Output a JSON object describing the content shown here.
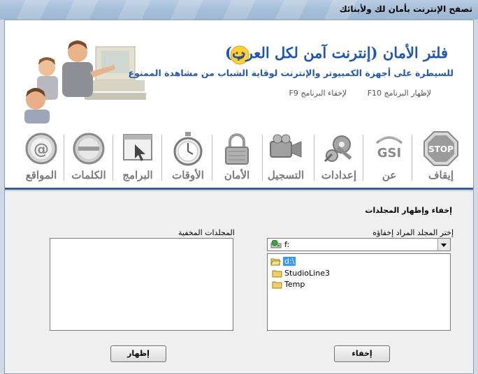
{
  "window": {
    "title": "تصفح الإنترنت بأمان لك ولأبنائك"
  },
  "header": {
    "app_title": "فلتر الأمان (إنترنت آمن لكل العرب)",
    "subtitle": "للسيطرة على أجهزة الكمبيوتر والإنترنت لوقاية الشباب من مشاهدة الممنوع",
    "hotkey_show": "لإظهار البرنامج F10",
    "hotkey_hide": "لإخفاء البرنامج F9"
  },
  "toolbar": {
    "items": [
      {
        "label": "إيقاف",
        "icon": "stop-sign-icon"
      },
      {
        "label": "عن",
        "icon": "gsi-logo-icon"
      },
      {
        "label": "إعدادات",
        "icon": "gears-icon"
      },
      {
        "label": "التسجيل",
        "icon": "video-camera-icon"
      },
      {
        "label": "الأمان",
        "icon": "padlock-icon"
      },
      {
        "label": "الأوقات",
        "icon": "stopwatch-icon"
      },
      {
        "label": "البرامج",
        "icon": "program-window-icon"
      },
      {
        "label": "الكلمات",
        "icon": "words-disc-icon"
      },
      {
        "label": "المواقع",
        "icon": "at-sign-icon"
      }
    ]
  },
  "panel": {
    "section_title": "إخفاء وإظهار المجلدات",
    "choose_label": "إختر المجلد المراد إخفاؤه",
    "hidden_label": "المجلدات المخفية",
    "drive": {
      "value": "f:"
    },
    "folders": [
      {
        "name": "d:\\",
        "selected": true,
        "open": true
      },
      {
        "name": "StudioLine3",
        "selected": false,
        "open": false
      },
      {
        "name": "Temp",
        "selected": false,
        "open": false
      }
    ],
    "hidden_folders": [],
    "hide_button": "إخفاء",
    "show_button": "إظهار"
  }
}
